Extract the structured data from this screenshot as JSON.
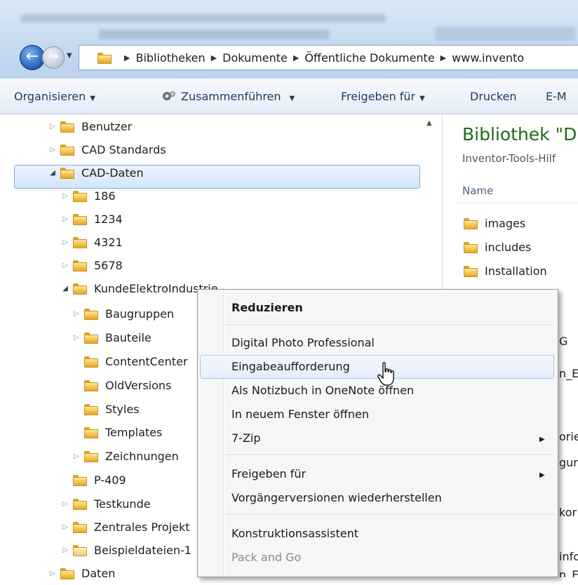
{
  "address": {
    "crumbs": [
      "Bibliotheken",
      "Dokumente",
      "Öffentliche Dokumente",
      "www.invento"
    ]
  },
  "toolbar": {
    "organize": "Organisieren",
    "merge": "Zusammenführen",
    "share": "Freigeben für",
    "print": "Drucken",
    "email": "E-M"
  },
  "tree": {
    "items": [
      {
        "label": "Benutzer"
      },
      {
        "label": "CAD Standards"
      },
      {
        "label": "CAD-Daten"
      },
      {
        "label": "186"
      },
      {
        "label": "1234"
      },
      {
        "label": "4321"
      },
      {
        "label": "5678"
      },
      {
        "label": "KundeElektroIndustrie"
      },
      {
        "label": "Baugruppen"
      },
      {
        "label": "Bauteile"
      },
      {
        "label": "ContentCenter"
      },
      {
        "label": "OldVersions"
      },
      {
        "label": "Styles"
      },
      {
        "label": "Templates"
      },
      {
        "label": "Zeichnungen"
      },
      {
        "label": "P-409"
      },
      {
        "label": "Testkunde"
      },
      {
        "label": "Zentrales Projekt"
      },
      {
        "label": "Beispieldateien-1"
      },
      {
        "label": "Daten"
      }
    ]
  },
  "right": {
    "title": "Bibliothek \"D",
    "subtitle": "Inventor-Tools-Hilf",
    "col_name": "Name",
    "files": [
      "images",
      "includes",
      "Installation"
    ],
    "partials": [
      "G",
      "n_E",
      "orie",
      "gur",
      "kor",
      "info",
      "n_E"
    ]
  },
  "context_menu": {
    "items": [
      {
        "label": "Reduzieren"
      },
      {
        "label": "Digital Photo Professional"
      },
      {
        "label": "Eingabeaufforderung"
      },
      {
        "label": "Als Notizbuch in OneNote öffnen"
      },
      {
        "label": "In neuem Fenster öffnen"
      },
      {
        "label": "7-Zip"
      },
      {
        "label": "Freigeben für"
      },
      {
        "label": "Vorgängerversionen wiederherstellen"
      },
      {
        "label": "Konstruktionsassistent"
      },
      {
        "label": "Pack and Go"
      }
    ]
  }
}
